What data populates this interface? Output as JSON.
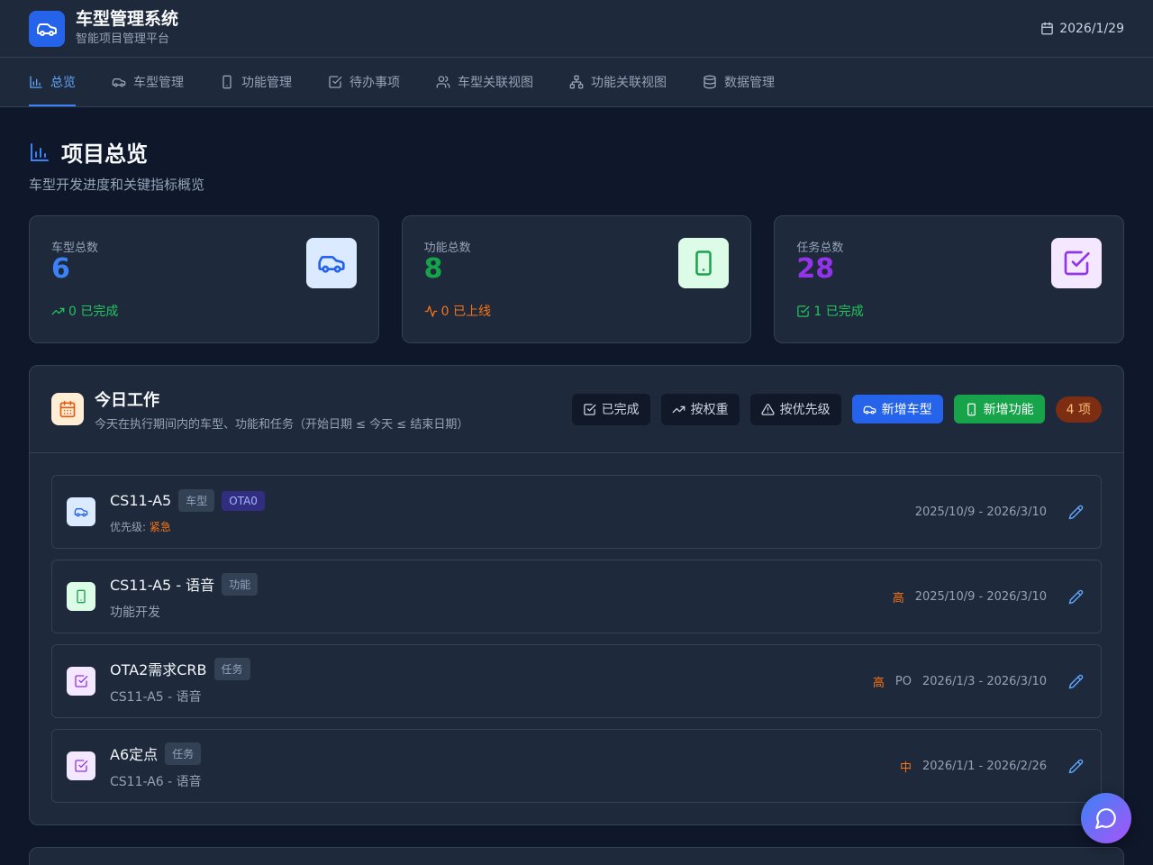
{
  "header": {
    "title": "车型管理系统",
    "subtitle": "智能项目管理平台",
    "date": "2026/1/29"
  },
  "nav": {
    "items": [
      {
        "label": "总览",
        "icon": "bar-chart-icon",
        "active": true
      },
      {
        "label": "车型管理",
        "icon": "car-icon"
      },
      {
        "label": "功能管理",
        "icon": "phone-icon"
      },
      {
        "label": "待办事项",
        "icon": "check-square-icon"
      },
      {
        "label": "车型关联视图",
        "icon": "users-icon"
      },
      {
        "label": "功能关联视图",
        "icon": "network-icon"
      },
      {
        "label": "数据管理",
        "icon": "database-icon"
      }
    ]
  },
  "page": {
    "title": "项目总览",
    "subtitle": "车型开发进度和关键指标概览"
  },
  "stats": [
    {
      "label": "车型总数",
      "value": "6",
      "foot": "0 已完成",
      "color": "#3b82f6",
      "foot_color": "#22c55e",
      "icon": "car-icon"
    },
    {
      "label": "功能总数",
      "value": "8",
      "foot": "0 已上线",
      "color": "#16a34a",
      "foot_color": "#f97316",
      "icon": "phone-icon"
    },
    {
      "label": "任务总数",
      "value": "28",
      "foot": "1 已完成",
      "color": "#9333ea",
      "foot_color": "#22c55e",
      "icon": "check-square-icon"
    }
  ],
  "today": {
    "title": "今日工作",
    "subtitle": "今天在执行期间内的车型、功能和任务（开始日期 ≤ 今天 ≤ 结束日期）",
    "actions": {
      "completed": "已完成",
      "by_weight": "按权重",
      "by_priority": "按优先级",
      "add_model": "新增车型",
      "add_feature": "新增功能"
    },
    "count": "4 项",
    "items": [
      {
        "name": "CS11-A5",
        "tag": "车型",
        "tag2": "OTA0",
        "sub_label": "优先级:",
        "sub_value": "紧急",
        "prio": "",
        "owner": "",
        "range": "2025/10/9 - 2026/3/10",
        "kind": "model"
      },
      {
        "name": "CS11-A5 - 语音",
        "tag": "功能",
        "sub": "功能开发",
        "prio": "高",
        "owner": "",
        "range": "2025/10/9 - 2026/3/10",
        "kind": "feature"
      },
      {
        "name": "OTA2需求CRB",
        "tag": "任务",
        "sub": "CS11-A5 - 语音",
        "prio": "高",
        "owner": "PO",
        "range": "2026/1/3 - 2026/3/10",
        "kind": "task"
      },
      {
        "name": "A6定点",
        "tag": "任务",
        "sub": "CS11-A6 - 语音",
        "prio": "中",
        "owner": "",
        "range": "2026/1/1 - 2026/2/26",
        "kind": "task"
      }
    ]
  }
}
